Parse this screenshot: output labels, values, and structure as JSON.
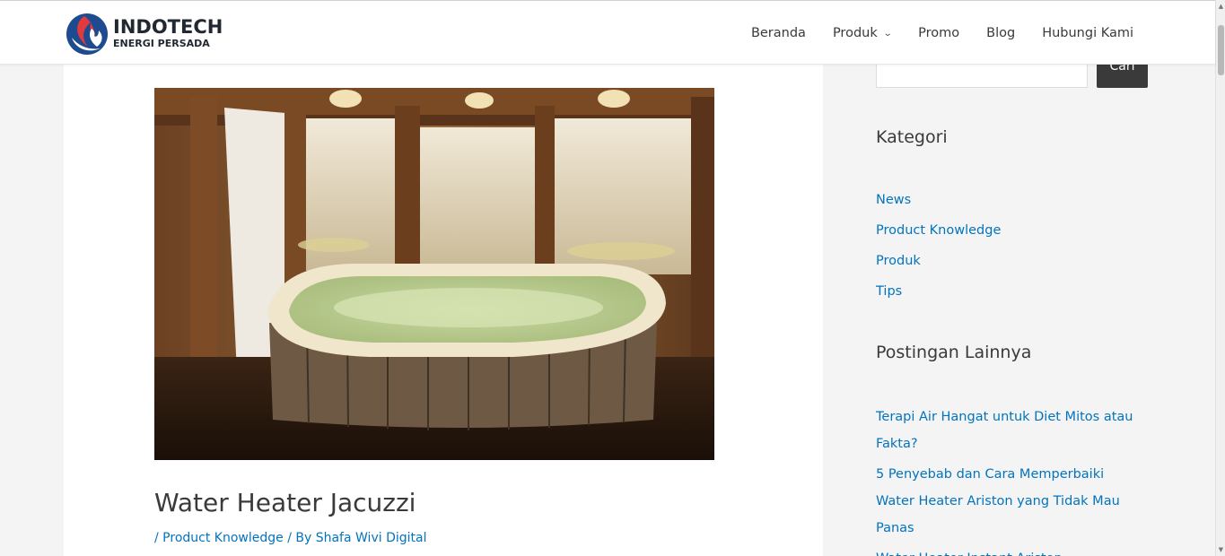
{
  "header": {
    "logo": {
      "main": "INDOTECH",
      "sub": "ENERGI PERSADA"
    },
    "nav": [
      {
        "label": "Beranda"
      },
      {
        "label": "Produk",
        "has_dropdown": true
      },
      {
        "label": "Promo"
      },
      {
        "label": "Blog"
      },
      {
        "label": "Hubungi Kami"
      }
    ]
  },
  "article": {
    "title": "Water Heater Jacuzzi",
    "meta": {
      "sep1": "/ ",
      "category": "Product Knowledge",
      "sep2": " / By ",
      "author": "Shafa Wivi Digital"
    },
    "image_alt": "Jacuzzi hot tub in wooden room"
  },
  "sidebar": {
    "search": {
      "button_label": "Cari",
      "placeholder": ""
    },
    "categories": {
      "title": "Kategori",
      "items": [
        "News",
        "Product Knowledge",
        "Produk",
        "Tips"
      ]
    },
    "posts": {
      "title": "Postingan Lainnya",
      "items": [
        "Terapi Air Hangat untuk Diet Mitos atau Fakta?",
        "5 Penyebab dan Cara Memperbaiki Water Heater Ariston yang Tidak Mau Panas",
        "Water Heater Instant Ariston"
      ]
    }
  },
  "colors": {
    "link": "#0274be",
    "text": "#3a3a3a",
    "page_bg": "#f4f4f4",
    "button_bg": "#3a3a3a",
    "logo_blue": "#1e4b8f",
    "logo_red": "#e03a3e"
  }
}
